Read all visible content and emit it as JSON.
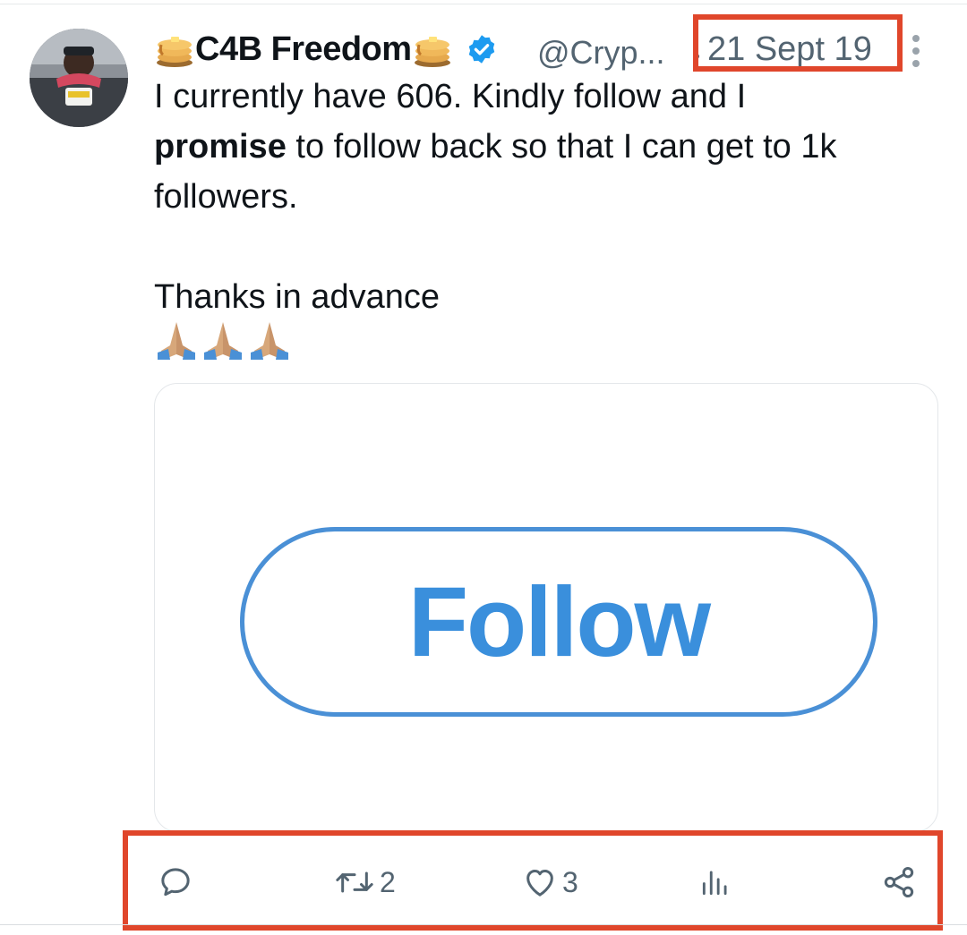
{
  "tweet": {
    "display_name": "C4B Freedom",
    "handle": "@Cryp...",
    "date": "21 Sept 19",
    "text": {
      "line1": "I currently have 606. Kindly follow and I",
      "bold_word": "promise",
      "line2_rest": " to follow back so that I can get to 1k",
      "line3": "followers.",
      "line4": "Thanks in advance"
    },
    "emoji_count": 3
  },
  "media": {
    "follow_label": "Follow"
  },
  "actions": {
    "reply_count": "",
    "retweet_count": "2",
    "like_count": "3",
    "views_count": ""
  },
  "icons": {
    "name_decoration": "pancake-icon",
    "verified": "verified-badge-icon",
    "more": "more-vertical-icon",
    "reply": "reply-icon",
    "retweet": "retweet-icon",
    "like": "heart-icon",
    "views": "views-icon",
    "share": "share-icon"
  },
  "colors": {
    "highlight_box": "#e0462b",
    "verified_blue": "#1d9bf0",
    "follow_blue": "#3a8fdc",
    "secondary_text": "#536471"
  }
}
